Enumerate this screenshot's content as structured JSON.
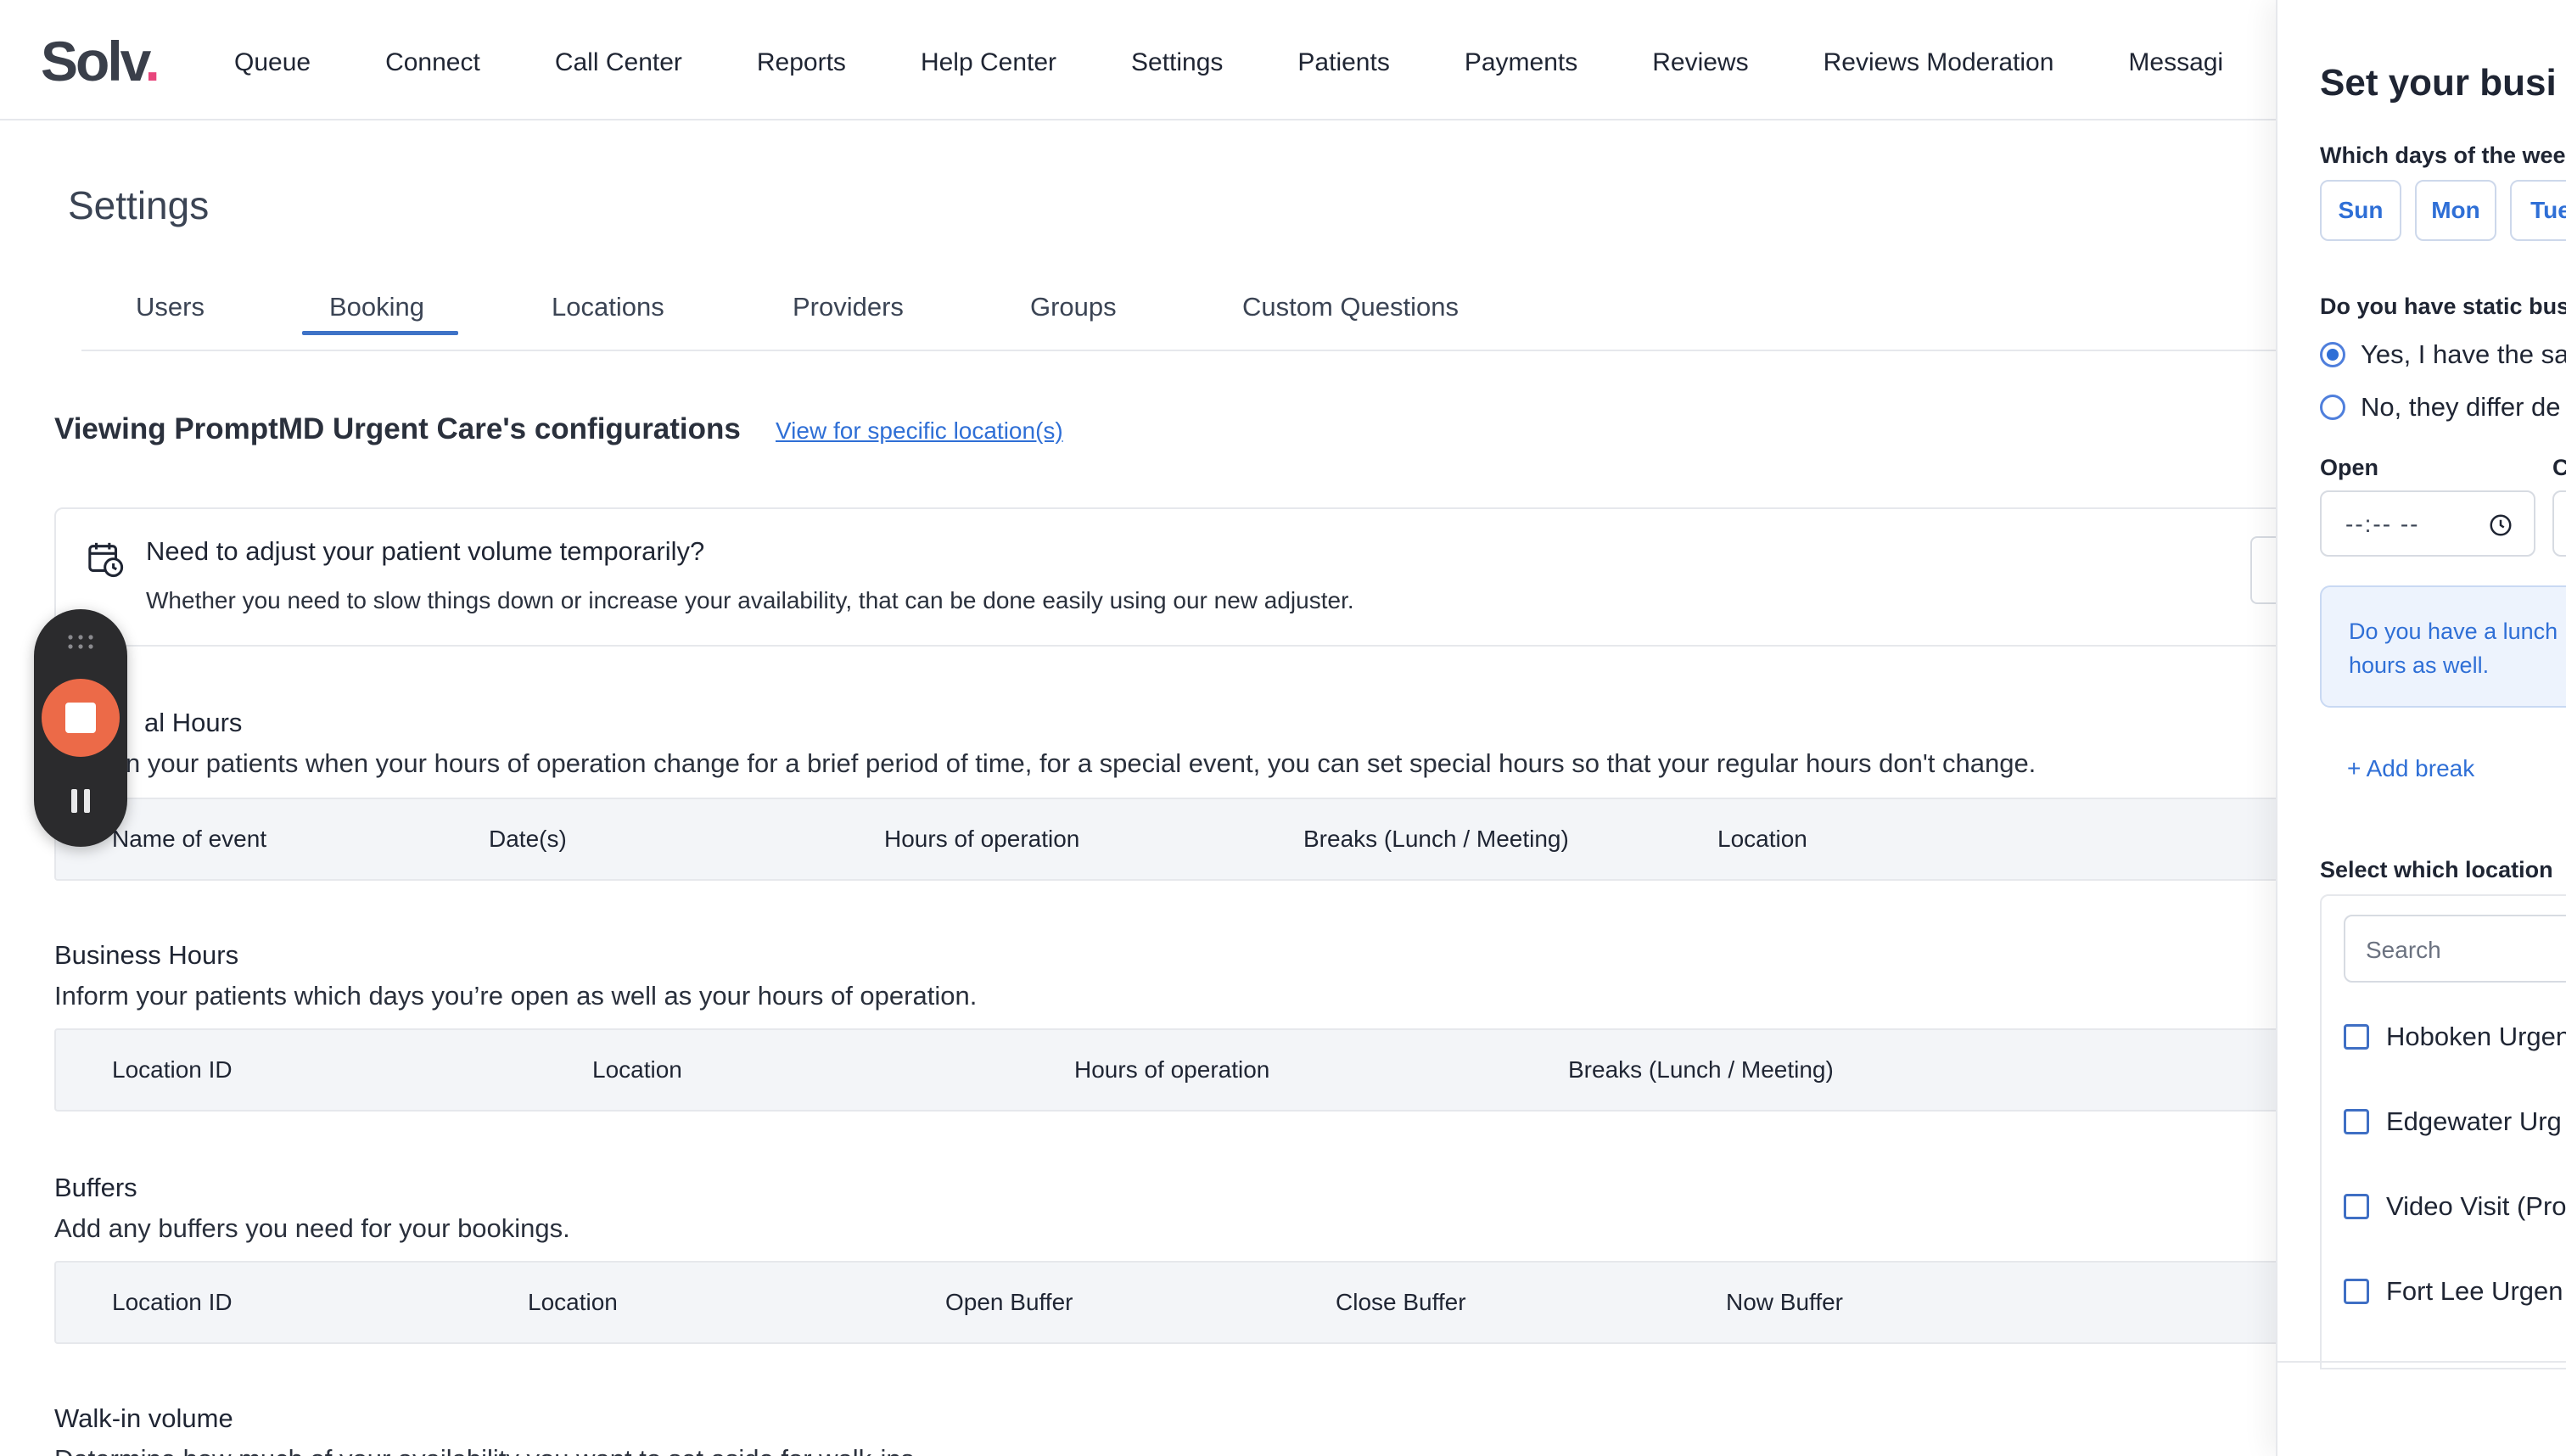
{
  "nav": {
    "logo_text": "Solv",
    "logo_dot": ".",
    "items": [
      "Queue",
      "Connect",
      "Call Center",
      "Reports",
      "Help Center",
      "Settings",
      "Patients",
      "Payments",
      "Reviews",
      "Reviews Moderation",
      "Messagi"
    ]
  },
  "page": {
    "title": "Settings",
    "tabs": [
      "Users",
      "Booking",
      "Locations",
      "Providers",
      "Groups",
      "Custom Questions"
    ],
    "active_tab": "Booking",
    "viewing": "Viewing PromptMD Urgent Care's configurations",
    "view_link": "View for specific location(s)"
  },
  "notice": {
    "title": "Need to adjust your patient volume temporarily?",
    "body": "Whether you need to slow things down or increase your availability, that can be done easily using our new adjuster."
  },
  "special_hours": {
    "title": "al Hours",
    "desc": "n your patients when your hours of operation change for a brief period of time, for a special event, you can set special hours so that your regular hours don't change.",
    "columns": [
      "Name of event",
      "Date(s)",
      "Hours of operation",
      "Breaks (Lunch / Meeting)",
      "Location"
    ]
  },
  "business_hours": {
    "title": "Business Hours",
    "desc": "Inform your patients which days you’re open as well as your hours of operation.",
    "columns": [
      "Location ID",
      "Location",
      "Hours of operation",
      "Breaks (Lunch / Meeting)"
    ]
  },
  "buffers": {
    "title": "Buffers",
    "desc": "Add any buffers you need for your bookings.",
    "columns": [
      "Location ID",
      "Location",
      "Open Buffer",
      "Close Buffer",
      "Now Buffer"
    ]
  },
  "walkin": {
    "title": "Walk-in volume",
    "desc": "Determine how much of your availability you want to set aside for walk-ins."
  },
  "drawer": {
    "title": "Set your busi",
    "days_label": "Which days of the wee",
    "days": [
      "Sun",
      "Mon",
      "Tue"
    ],
    "static_label": "Do you have static bus",
    "radio_yes": "Yes, I have the sa",
    "radio_no": "No, they differ de",
    "open_label": "Open",
    "close_label": "C",
    "time_value": "--:-- --",
    "lunch_text": "Do you have a lunch hours as well.",
    "add_break": "+ Add break",
    "locations_label": "Select which location",
    "search_placeholder": "Search",
    "locations": [
      "Hoboken Urgen",
      "Edgewater Urg",
      "Video Visit (Pro",
      "Fort Lee Urgen"
    ]
  },
  "colors": {
    "accent": "#2f6fd6",
    "brand_dot": "#e8467c",
    "recorder_bg": "#2b2b2d",
    "recorder_stop": "#ec6a48"
  }
}
